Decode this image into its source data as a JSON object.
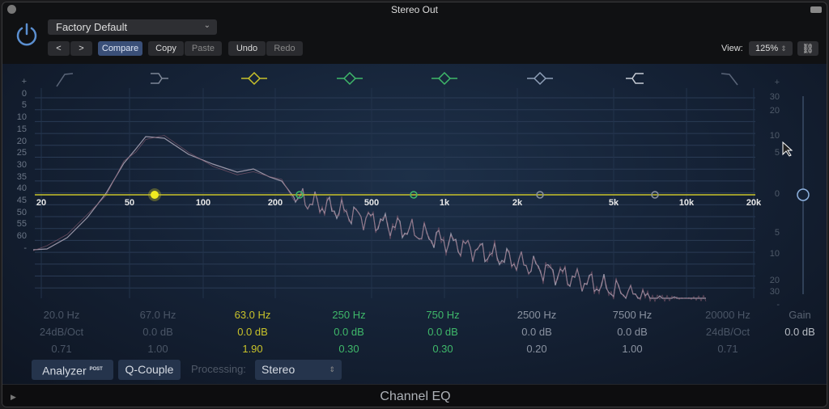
{
  "window": {
    "title": "Stereo Out"
  },
  "header": {
    "preset": "Factory Default",
    "prev": "<",
    "next": ">",
    "compare": "Compare",
    "copy": "Copy",
    "paste": "Paste",
    "undo": "Undo",
    "redo": "Redo",
    "view_label": "View:",
    "view_value": "125%"
  },
  "scale_left": [
    "+",
    "0",
    "5",
    "10",
    "15",
    "20",
    "25",
    "30",
    "35",
    "40",
    "45",
    "50",
    "55",
    "60",
    "-"
  ],
  "scale_right": [
    "+",
    "30",
    "20",
    "10",
    "5",
    "0",
    "5",
    "10",
    "20",
    "30",
    "-"
  ],
  "freq_labels": [
    "20",
    "50",
    "100",
    "200",
    "500",
    "1k",
    "2k",
    "5k",
    "10k",
    "20k"
  ],
  "bands": [
    {
      "freq": "20.0 Hz",
      "gain": "24dB/Oct",
      "q": "0.71",
      "color": "#4a5566",
      "icon": "low-cut-icon"
    },
    {
      "freq": "67.0 Hz",
      "gain": "0.0 dB",
      "q": "1.00",
      "color": "#4a5566",
      "icon": "low-shelf-icon"
    },
    {
      "freq": "63.0 Hz",
      "gain": "0.0 dB",
      "q": "1.90",
      "color": "#c8c22a",
      "icon": "bell-icon"
    },
    {
      "freq": "250 Hz",
      "gain": "0.0 dB",
      "q": "0.30",
      "color": "#3fb86a",
      "icon": "bell-icon"
    },
    {
      "freq": "750 Hz",
      "gain": "0.0 dB",
      "q": "0.30",
      "color": "#3fb86a",
      "icon": "bell-icon"
    },
    {
      "freq": "2500 Hz",
      "gain": "0.0 dB",
      "q": "0.20",
      "color": "#8a92a0",
      "icon": "bell-icon"
    },
    {
      "freq": "7500 Hz",
      "gain": "0.0 dB",
      "q": "1.00",
      "color": "#8a92a0",
      "icon": "high-shelf-icon"
    },
    {
      "freq": "20000 Hz",
      "gain": "24dB/Oct",
      "q": "0.71",
      "color": "#4a5566",
      "icon": "high-cut-icon"
    }
  ],
  "gain": {
    "label": "Gain",
    "value": "0.0 dB"
  },
  "bottom": {
    "analyzer": "Analyzer",
    "post": "POST",
    "qcouple": "Q-Couple",
    "processing_label": "Processing:",
    "processing_value": "Stereo"
  },
  "footer": {
    "plugin_name": "Channel EQ"
  },
  "colors": {
    "eq_line": "#c8c22a",
    "accent": "#3a4f78"
  }
}
